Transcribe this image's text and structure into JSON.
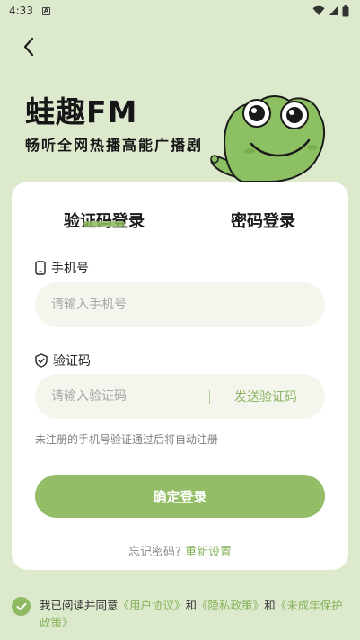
{
  "status_bar": {
    "time": "4:33",
    "icons": [
      "app-notification-icon",
      "wifi-icon",
      "signal-icon",
      "battery-icon"
    ]
  },
  "header": {
    "back_icon": "chevron-left-icon",
    "brand_title": "蛙趣FM",
    "slogan": "畅听全网热播高能广播剧",
    "mascot": "frog-mascot"
  },
  "tabs": [
    {
      "label": "验证码登录",
      "active": true
    },
    {
      "label": "密码登录",
      "active": false
    }
  ],
  "form": {
    "phone": {
      "label": "手机号",
      "icon": "phone-icon",
      "placeholder": "请输入手机号",
      "value": ""
    },
    "code": {
      "label": "验证码",
      "icon": "shield-check-icon",
      "placeholder": "请输入验证码",
      "value": "",
      "send_label": "发送验证码"
    },
    "hint": "未注册的手机号验证通过后将自动注册",
    "submit_label": "确定登录",
    "forgot_prefix": "忘记密码?",
    "reset_link": "重新设置"
  },
  "agreement": {
    "checked": true,
    "prefix": "我已阅读并同意",
    "user_agreement": "《用户协议》",
    "and_1": "和",
    "privacy_policy": "《隐私政策》",
    "and_2": "和",
    "minor_policy": "《未成年保护政策》"
  },
  "colors": {
    "background": "#dce9cd",
    "accent": "#94bd67",
    "link": "#87b35c",
    "frog_green": "#8cc063"
  }
}
